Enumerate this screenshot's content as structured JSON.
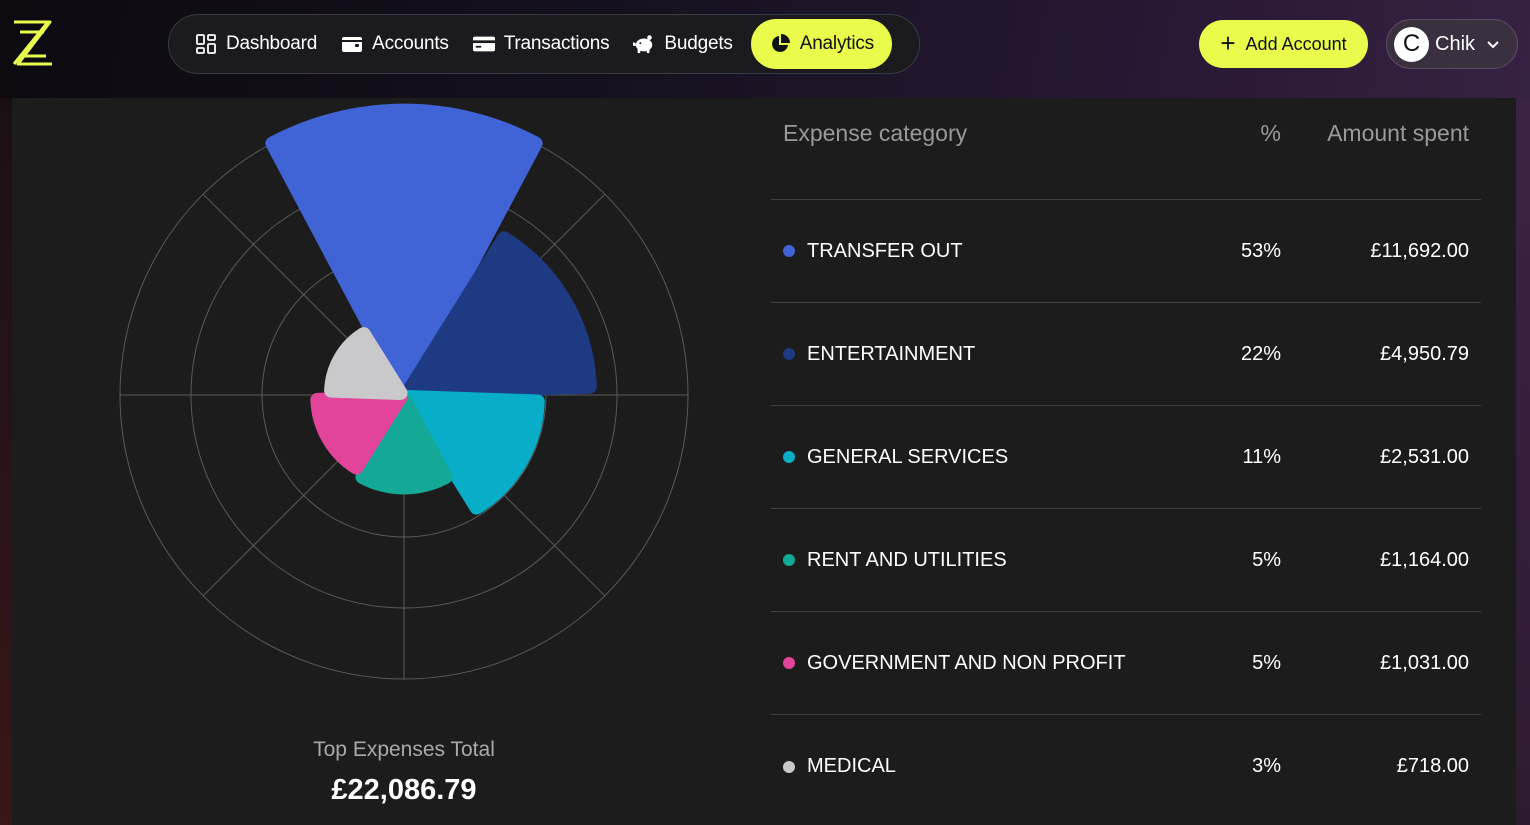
{
  "nav": {
    "items": [
      {
        "label": "Dashboard",
        "icon": "grid-icon"
      },
      {
        "label": "Accounts",
        "icon": "wallet-icon"
      },
      {
        "label": "Transactions",
        "icon": "card-icon"
      },
      {
        "label": "Budgets",
        "icon": "piggy-bank-icon"
      },
      {
        "label": "Analytics",
        "icon": "pie-chart-icon"
      }
    ],
    "active": "Analytics"
  },
  "header": {
    "add_account_label": "Add Account",
    "user_initial": "C",
    "user_name": "Chik"
  },
  "colors": {
    "accent": "#e9fb4b",
    "transfer_out": "#4063d6",
    "entertainment": "#1e3a82",
    "general_services": "#08aec8",
    "rent_and_utilities": "#13a996",
    "government": "#e2449a",
    "medical": "#c9c9cc"
  },
  "table": {
    "headers": {
      "category": "Expense category",
      "percent": "%",
      "amount": "Amount spent"
    },
    "rows": [
      {
        "category": "TRANSFER OUT",
        "percent": "53%",
        "amount": "£11,692.00",
        "color": "#4063d6"
      },
      {
        "category": "ENTERTAINMENT",
        "percent": "22%",
        "amount": "£4,950.79",
        "color": "#1e3a82"
      },
      {
        "category": "GENERAL SERVICES",
        "percent": "11%",
        "amount": "£2,531.00",
        "color": "#08aec8"
      },
      {
        "category": "RENT AND UTILITIES",
        "percent": "5%",
        "amount": "£1,164.00",
        "color": "#13a996"
      },
      {
        "category": "GOVERNMENT AND NON PROFIT",
        "percent": "5%",
        "amount": "£1,031.00",
        "color": "#e2449a"
      },
      {
        "category": "MEDICAL",
        "percent": "3%",
        "amount": "£718.00",
        "color": "#c9c9cc"
      }
    ]
  },
  "summary": {
    "label": "Top Expenses Total",
    "value": "£22,086.79"
  },
  "chart_data": {
    "type": "polar-area",
    "categories": [
      "TRANSFER OUT",
      "ENTERTAINMENT",
      "GENERAL SERVICES",
      "RENT AND UTILITIES",
      "GOVERNMENT AND NON PROFIT",
      "MEDICAL"
    ],
    "values": [
      11692.0,
      4950.79,
      2531.0,
      1164.0,
      1031.0,
      718.0
    ],
    "colors": [
      "#4063d6",
      "#1e3a82",
      "#08aec8",
      "#13a996",
      "#e2449a",
      "#c9c9cc"
    ],
    "rlim": [
      0,
      12000
    ],
    "grid": true
  }
}
